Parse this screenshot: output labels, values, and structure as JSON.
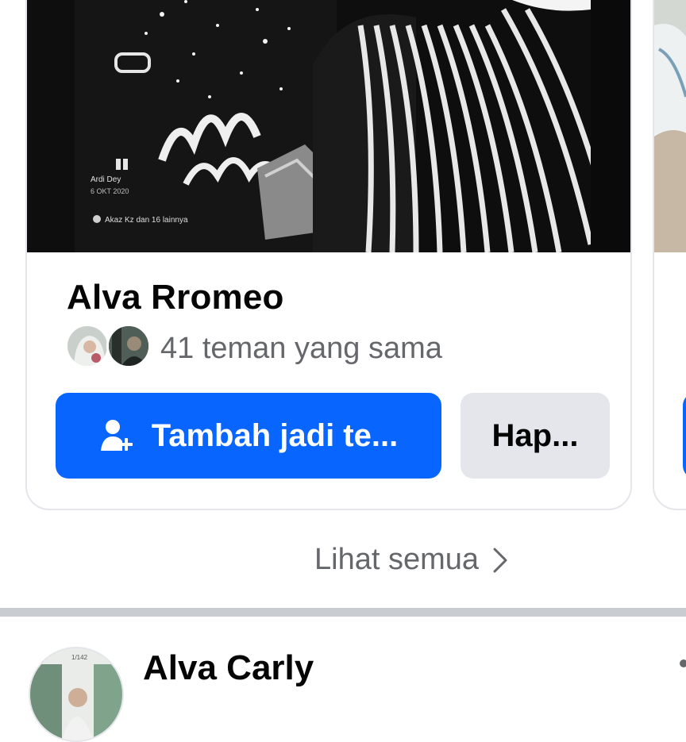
{
  "suggestion_card": {
    "name": "Alva Rromeo",
    "mutual_friends": "41 teman yang sama",
    "add_button_label": "Tambah jadi te...",
    "remove_button_label": "Hap...",
    "photo_overlay_texts": [
      "Ardi Dey",
      "6 OKT 2020",
      "Akaz Kz dan 16 lainnya"
    ]
  },
  "see_all": {
    "label": "Lihat semua"
  },
  "next_person": {
    "name": "Alva Carly",
    "avatar_counter": "1/142"
  },
  "colors": {
    "primary_button": "#0866ff",
    "secondary_button": "#e4e6eb",
    "secondary_text": "#65676b",
    "primary_text": "#050505",
    "divider": "#c9ccd1"
  },
  "icons": [
    "add-friend-icon",
    "chevron-right-icon"
  ]
}
